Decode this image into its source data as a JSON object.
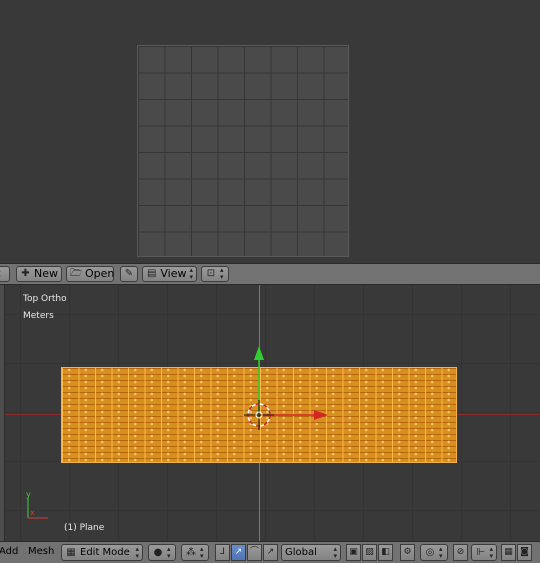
{
  "image_editor": {
    "header": {
      "new_label": "New",
      "open_label": "Open",
      "view_label": "View"
    }
  },
  "viewport": {
    "view_name": "Top Ortho",
    "units": "Meters",
    "object_label": "(1) Plane",
    "axis_label_x": "x",
    "axis_label_y": "y"
  },
  "footer": {
    "add_label": "Add",
    "mesh_label": "Mesh",
    "mode_label": "Edit Mode",
    "orientation_label": "Global"
  },
  "colors": {
    "background": "#393939",
    "header": "#727272",
    "selection_orange": "#d6901e",
    "x_axis": "#8a2a2a",
    "y_axis": "#3f9f3f"
  }
}
